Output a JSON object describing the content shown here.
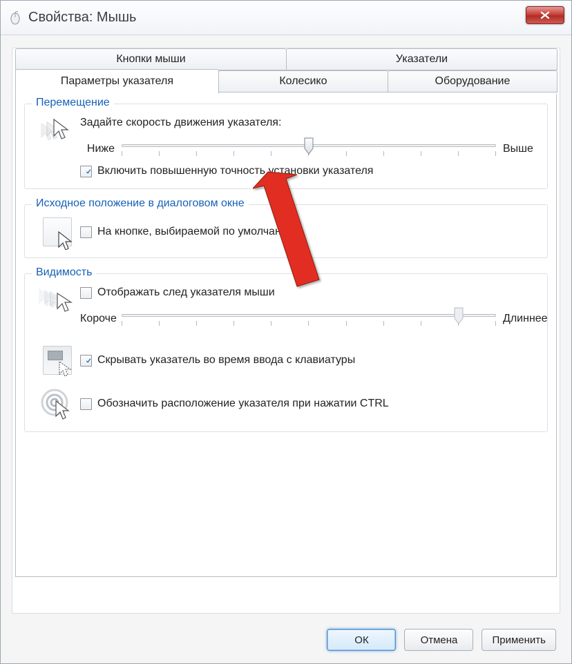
{
  "window": {
    "title": "Свойства: Мышь"
  },
  "tabs": {
    "row1": [
      "Кнопки мыши",
      "Указатели"
    ],
    "row2": [
      "Параметры указателя",
      "Колесико",
      "Оборудование"
    ],
    "active": "Параметры указателя"
  },
  "group_motion": {
    "legend": "Перемещение",
    "speed_label": "Задайте скорость движения указателя:",
    "slider_min": "Ниже",
    "slider_max": "Выше",
    "slider_value": 5,
    "slider_ticks": 11,
    "enhance_checked": true,
    "enhance_label": "Включить повышенную точность установки указателя"
  },
  "group_snap": {
    "legend": "Исходное положение в диалоговом окне",
    "snap_checked": false,
    "snap_label": "На кнопке, выбираемой по умолчанию"
  },
  "group_vis": {
    "legend": "Видимость",
    "trail_checked": false,
    "trail_label": "Отображать след указателя мыши",
    "trail_min": "Короче",
    "trail_max": "Длиннее",
    "trail_value": 9,
    "trail_ticks": 11,
    "hide_checked": true,
    "hide_label": "Скрывать указатель во время ввода с клавиатуры",
    "ctrl_checked": false,
    "ctrl_label": "Обозначить расположение указателя при нажатии CTRL"
  },
  "buttons": {
    "ok": "ОК",
    "cancel": "Отмена",
    "apply": "Применить"
  }
}
